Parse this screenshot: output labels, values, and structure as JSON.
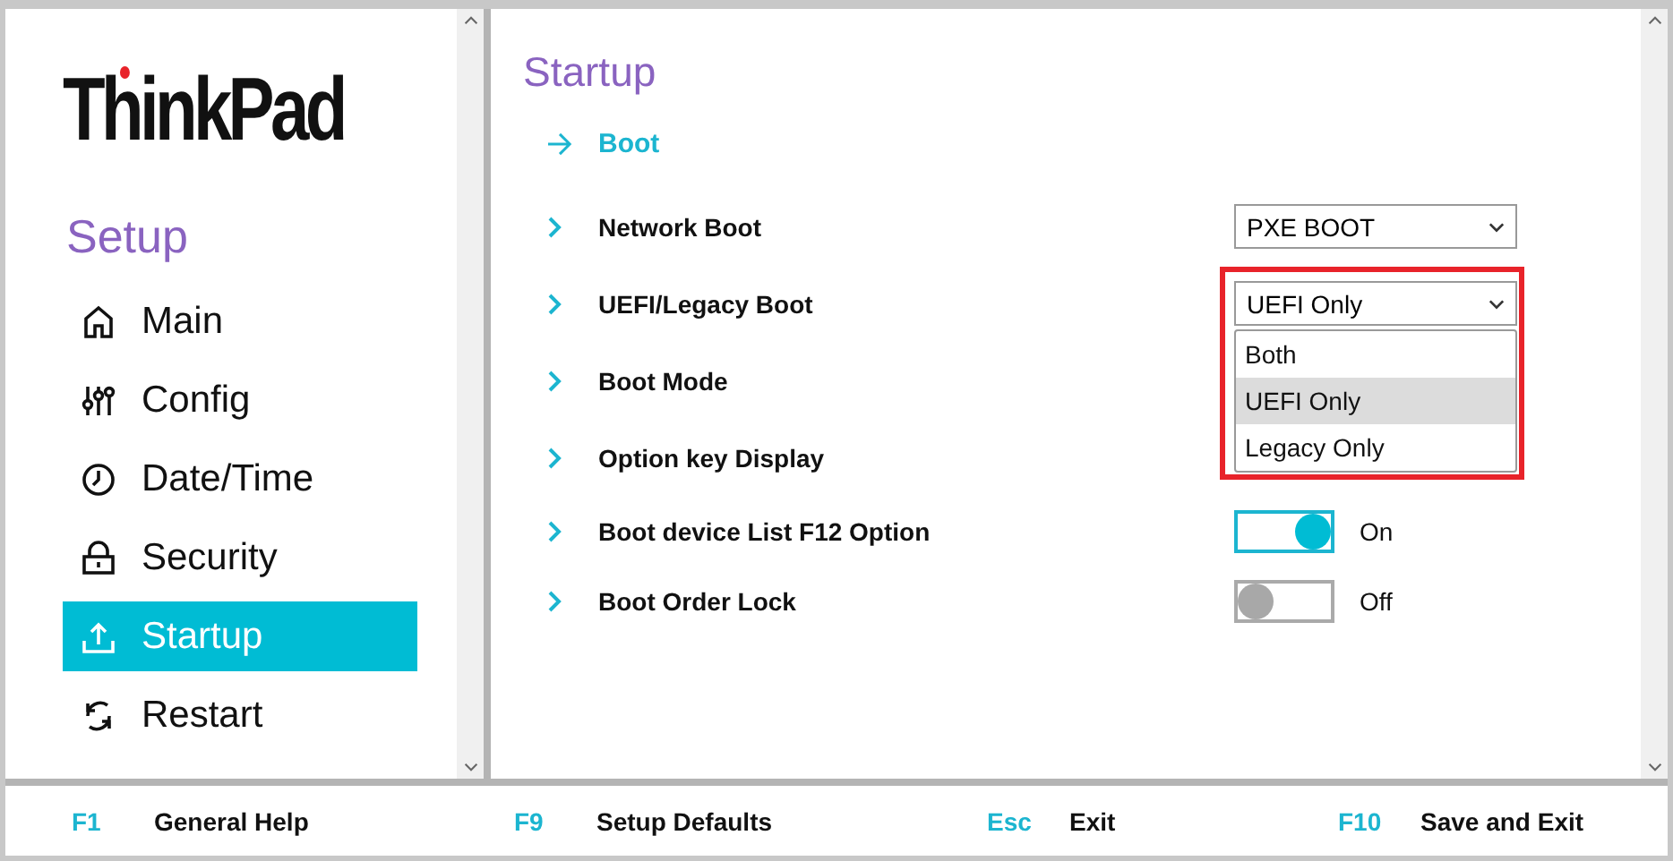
{
  "logo": {
    "text": "ThinkPad"
  },
  "sidebar": {
    "title": "Setup",
    "items": [
      {
        "label": "Main",
        "kind": "home",
        "selected": false
      },
      {
        "label": "Config",
        "kind": "sliders",
        "selected": false
      },
      {
        "label": "Date/Time",
        "kind": "clock",
        "selected": false
      },
      {
        "label": "Security",
        "kind": "lock",
        "selected": false
      },
      {
        "label": "Startup",
        "kind": "upload",
        "selected": true
      },
      {
        "label": "Restart",
        "kind": "refresh",
        "selected": false
      }
    ]
  },
  "main": {
    "title": "Startup",
    "section": "Boot",
    "rows": [
      {
        "label": "Network Boot",
        "control": {
          "kind": "select",
          "value": "PXE BOOT"
        }
      },
      {
        "label": "UEFI/Legacy Boot",
        "control": {
          "kind": "select",
          "value": "UEFI Only",
          "open": true,
          "highlighted": true,
          "options": [
            {
              "label": "Both",
              "selected": false
            },
            {
              "label": "UEFI Only",
              "selected": true
            },
            {
              "label": "Legacy Only",
              "selected": false
            }
          ]
        }
      },
      {
        "label": "Boot Mode"
      },
      {
        "label": "Option key Display"
      },
      {
        "label": "Boot device List F12 Option",
        "control": {
          "kind": "switch",
          "on": true,
          "text": "On"
        }
      },
      {
        "label": "Boot Order Lock",
        "control": {
          "kind": "switch",
          "on": false,
          "text": "Off"
        }
      }
    ]
  },
  "footer": [
    {
      "key": "F1",
      "label": "General Help"
    },
    {
      "key": "F9",
      "label": "Setup Defaults"
    },
    {
      "key": "Esc",
      "label": "Exit"
    },
    {
      "key": "F10",
      "label": "Save and Exit"
    }
  ]
}
